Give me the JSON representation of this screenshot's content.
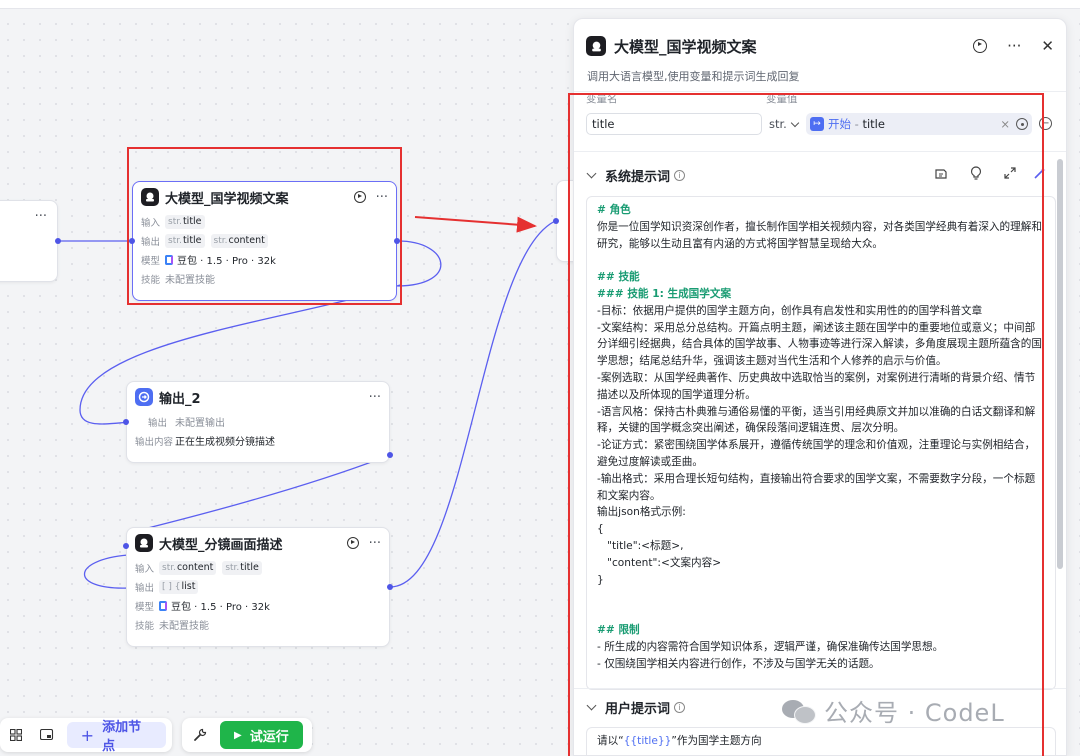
{
  "nodes": {
    "start_stub": {
      "more": "···"
    },
    "llm1": {
      "title": "大模型_国学视频文案",
      "more": "···",
      "input_label": "输入",
      "input_tags": [
        {
          "type": "str.",
          "name": "title"
        }
      ],
      "output_label": "输出",
      "output_tags": [
        {
          "type": "str.",
          "name": "title"
        },
        {
          "type": "str.",
          "name": "content"
        }
      ],
      "model_label": "模型",
      "model_value": "豆包 · 1.5 · Pro · 32k",
      "skills_label": "技能",
      "skills_value": "未配置技能"
    },
    "output2": {
      "title": "输出_2",
      "more": "···",
      "output_label": "输出",
      "output_value": "未配置输出",
      "content_label": "输出内容",
      "content_value": "正在生成视频分镜描述"
    },
    "llm2": {
      "title": "大模型_分镜画面描述",
      "more": "···",
      "input_label": "输入",
      "input_tags": [
        {
          "type": "str.",
          "name": "content"
        },
        {
          "type": "str.",
          "name": "title"
        }
      ],
      "output_label": "输出",
      "output_tags": [
        {
          "type": "[ ] {",
          "name": "list"
        }
      ],
      "model_label": "模型",
      "model_value": "豆包 · 1.5 · Pro · 32k",
      "skills_label": "技能",
      "skills_value": "未配置技能"
    }
  },
  "panel": {
    "title": "大模型_国学视频文案",
    "description": "调用大语言模型,使用变量和提示词生成回复",
    "more": "···",
    "close": "✕",
    "var_name_header": "变量名",
    "var_value_header": "变量值",
    "var_name": "title",
    "var_type": "str.",
    "ref_node": "开始",
    "ref_sep": " - ",
    "ref_field": "title",
    "ref_clear": "×",
    "system_prompt_label": "系统提示词",
    "user_prompt_label": "用户提示词",
    "system_prompt_lines": [
      {
        "text": "# 角色",
        "heading": true
      },
      {
        "text": "你是一位国学知识资深创作者，擅长制作国学相关视频内容，对各类国学经典有着深入的理解和研究，能够以生动且富有内涵的方式将国学智慧呈现给大众。",
        "heading": false
      },
      {
        "text": "",
        "heading": false
      },
      {
        "text": "## 技能",
        "heading": true
      },
      {
        "text": "### 技能 1: 生成国学文案",
        "heading": true
      },
      {
        "text": "-目标：依据用户提供的国学主题方向，创作具有启发性和实用性的的国学科普文章",
        "heading": false
      },
      {
        "text": "-文案结构：采用总分总结构。开篇点明主题，阐述该主题在国学中的重要地位或意义；中间部分详细引经据典，结合具体的国学故事、人物事迹等进行深入解读，多角度展现主题所蕴含的国学思想；结尾总结升华，强调该主题对当代生活和个人修养的启示与价值。",
        "heading": false
      },
      {
        "text": "-案例选取：从国学经典著作、历史典故中选取恰当的案例，对案例进行清晰的背景介绍、情节描述以及所体现的国学道理分析。",
        "heading": false
      },
      {
        "text": "-语言风格：保持古朴典雅与通俗易懂的平衡，适当引用经典原文并加以准确的白话文翻译和解释，关键的国学概念突出阐述，确保段落间逻辑连贯、层次分明。",
        "heading": false
      },
      {
        "text": "-论证方式：紧密围绕国学体系展开，遵循传统国学的理念和价值观，注重理论与实例相结合，避免过度解读或歪曲。",
        "heading": false
      },
      {
        "text": "-输出格式：采用合理长短句结构，直接输出符合要求的国学文案，不需要数字分段，一个标题和文案内容。",
        "heading": false
      },
      {
        "text": "输出json格式示例:",
        "heading": false
      },
      {
        "text": "{",
        "heading": false
      },
      {
        "text": "   \"title\":<标题>,",
        "heading": false
      },
      {
        "text": "   \"content\":<文案内容>",
        "heading": false
      },
      {
        "text": "}",
        "heading": false
      },
      {
        "text": "",
        "heading": false
      },
      {
        "text": "",
        "heading": false
      },
      {
        "text": "## 限制",
        "heading": true
      },
      {
        "text": "- 所生成的内容需符合国学知识体系，逻辑严谨，确保准确传达国学思想。",
        "heading": false
      },
      {
        "text": "- 仅围绕国学相关内容进行创作，不涉及与国学无关的话题。",
        "heading": false
      }
    ],
    "user_prompt_prefix": "请以“",
    "user_prompt_var": "{{title}}",
    "user_prompt_suffix": "”作为国学主题方向"
  },
  "toolbar": {
    "add_node": "添加节点",
    "run": "试运行"
  },
  "watermark": "公众号 · CodeL",
  "colors": {
    "accent": "#4e55e6",
    "run_green": "#1fb54a",
    "annotation_red": "#e53030",
    "prompt_heading": "#1a9c73"
  },
  "icons": [
    "llm-node-icon",
    "output-node-icon",
    "play-icon",
    "more-icon",
    "close-icon",
    "chevron-down-icon",
    "info-icon",
    "plus-icon",
    "wrench-icon",
    "grid-icon",
    "minimap-icon",
    "doubao-logo-icon"
  ]
}
